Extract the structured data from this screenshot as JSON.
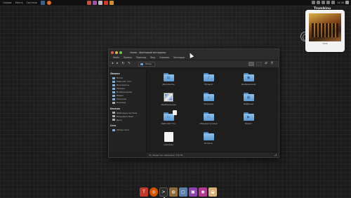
{
  "colors": {
    "desktop_bg": "#1b1b1b",
    "panel_bg": "#101010",
    "window_bg": "#1e1e1e",
    "sidebar_bg": "#232323",
    "folder_blue": "#6fa8dc",
    "close_button": "#e35b4b",
    "minimize_button": "#e0b54a",
    "maximize_button": "#7bbf4f"
  },
  "top_panel": {
    "menu": [
      "Сервис",
      "Места",
      "Система"
    ],
    "launchers": [
      {
        "icon": "terminal-icon",
        "color": "#3b5d8f"
      },
      {
        "icon": "firefox-icon",
        "color": "#e06b2a"
      }
    ],
    "tray_launchers": [
      {
        "icon": "app-icon-1",
        "color": "#c0503f"
      },
      {
        "icon": "app-icon-2",
        "color": "#9b52a8"
      },
      {
        "icon": "app-icon-3",
        "color": "#bbbbbb"
      },
      {
        "icon": "app-icon-4",
        "color": "#cc3b2e"
      },
      {
        "icon": "app-icon-5",
        "color": "#d1902e"
      }
    ],
    "clock": "14:38"
  },
  "widget": {
    "title": "Trombinu",
    "caption": "CCCP"
  },
  "window": {
    "title": "Home - Файловый менеджер",
    "menu": [
      "Файл",
      "Правка",
      "Переход",
      "Вид",
      "Справка",
      "Закладки"
    ],
    "toolbar_buttons": [
      {
        "name": "back-button",
        "glyph": "◂"
      },
      {
        "name": "forward-button",
        "glyph": "▸"
      },
      {
        "name": "reload-button",
        "glyph": "↻"
      },
      {
        "name": "edit-button",
        "glyph": "✎"
      }
    ],
    "breadcrumb": [
      "Home"
    ],
    "sidebar": {
      "places_header": "Личное",
      "places": [
        "Home",
        "Рабочий стол",
        "Документы",
        "Музыка",
        "Изображения",
        "Видео",
        "Загрузки",
        "Корзина"
      ],
      "devices_header": "Devices",
      "devices": [
        "Файловая система",
        "Filesystem Root",
        "Диск"
      ],
      "network_header": "Сеть",
      "network": [
        "Обзор сети"
      ]
    },
    "files": [
      {
        "label": "Документы",
        "type": "folder",
        "glyph": "▤"
      },
      {
        "label": "Музыка",
        "type": "folder",
        "glyph": "♪"
      },
      {
        "label": "Изображения",
        "type": "folder",
        "glyph": "▣"
      },
      {
        "label": "Изображение",
        "type": "image",
        "glyph": ""
      },
      {
        "label": "Загрузки",
        "type": "folder",
        "glyph": "↓"
      },
      {
        "label": "Шаблоны",
        "type": "folder",
        "glyph": "▦"
      },
      {
        "label": "Рабочий стол",
        "type": "folder",
        "glyph": "▭"
      },
      {
        "label": "Общедоступные",
        "type": "folder",
        "glyph": "⚇"
      },
      {
        "label": "Видео",
        "type": "folder",
        "glyph": "▶"
      },
      {
        "label": "examples",
        "type": "document",
        "glyph": ""
      },
      {
        "label": "Dropbox",
        "type": "folder",
        "glyph": ""
      }
    ],
    "status": "11 объектов, Свободно: 9,5 ГБ"
  },
  "dock": [
    {
      "icon": "dock-app-1",
      "color": "#c0392b",
      "glyph": "T"
    },
    {
      "icon": "chrome-icon",
      "color": "#d35400",
      "glyph": "◎"
    },
    {
      "icon": "terminal-icon",
      "color": "#2c2c2c",
      "glyph": ">"
    },
    {
      "icon": "dock-app-4",
      "color": "#8e6b3a",
      "glyph": "◍"
    },
    {
      "icon": "dock-app-5",
      "color": "#5b7fa8",
      "glyph": "▢"
    },
    {
      "icon": "dock-app-6",
      "color": "#8e44ad",
      "glyph": "▣"
    },
    {
      "icon": "dock-app-7",
      "color": "#b03a8e",
      "glyph": "◉"
    },
    {
      "icon": "dock-app-8",
      "color": "#d8b27a",
      "glyph": "◒"
    }
  ]
}
